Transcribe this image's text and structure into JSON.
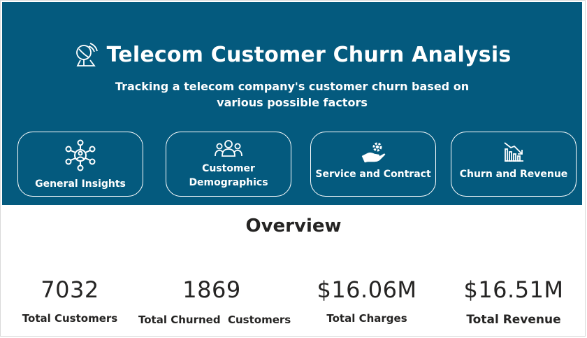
{
  "header": {
    "title": "Telecom Customer Churn Analysis",
    "subtitle": "Tracking a telecom company's customer churn based on various possible factors",
    "logo_icon": "satellite-dish-icon",
    "background_color": "#045a7e"
  },
  "nav": [
    {
      "label": "General Insights",
      "icon": "network-icon"
    },
    {
      "label": "Customer Demographics",
      "icon": "people-group-icon"
    },
    {
      "label": "Service and Contract",
      "icon": "hand-gear-icon"
    },
    {
      "label": "Churn and Revenue",
      "icon": "declining-chart-icon"
    }
  ],
  "overview": {
    "heading": "Overview",
    "kpis": [
      {
        "value": "7032",
        "label": "Total Customers"
      },
      {
        "value": "1869",
        "label": "Total Churned  Customers"
      },
      {
        "value": "$16.06M",
        "label": "Total Charges"
      },
      {
        "value": "$16.51M",
        "label": "Total Revenue"
      }
    ]
  }
}
